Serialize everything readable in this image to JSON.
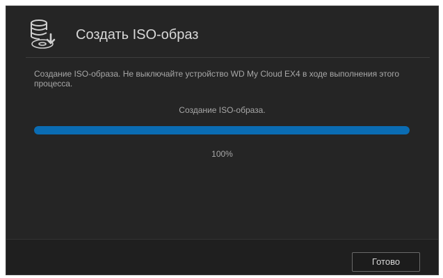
{
  "dialog": {
    "title": "Создать ISO-образ",
    "icon": "disk-image-icon",
    "message": "Создание ISO-образа. Не выключайте устройство WD My Cloud EX4 в ходе выполнения этого процесса.",
    "status": "Создание ISO-образа.",
    "progress": {
      "value": 1.0,
      "label": "100%"
    },
    "done_label": "Готово"
  },
  "colors": {
    "background": "#252525",
    "progress_fill": "#0a6cb3",
    "progress_track": "#3c3c3c",
    "text": "#a8a8a8",
    "title": "#d8d8d8"
  }
}
